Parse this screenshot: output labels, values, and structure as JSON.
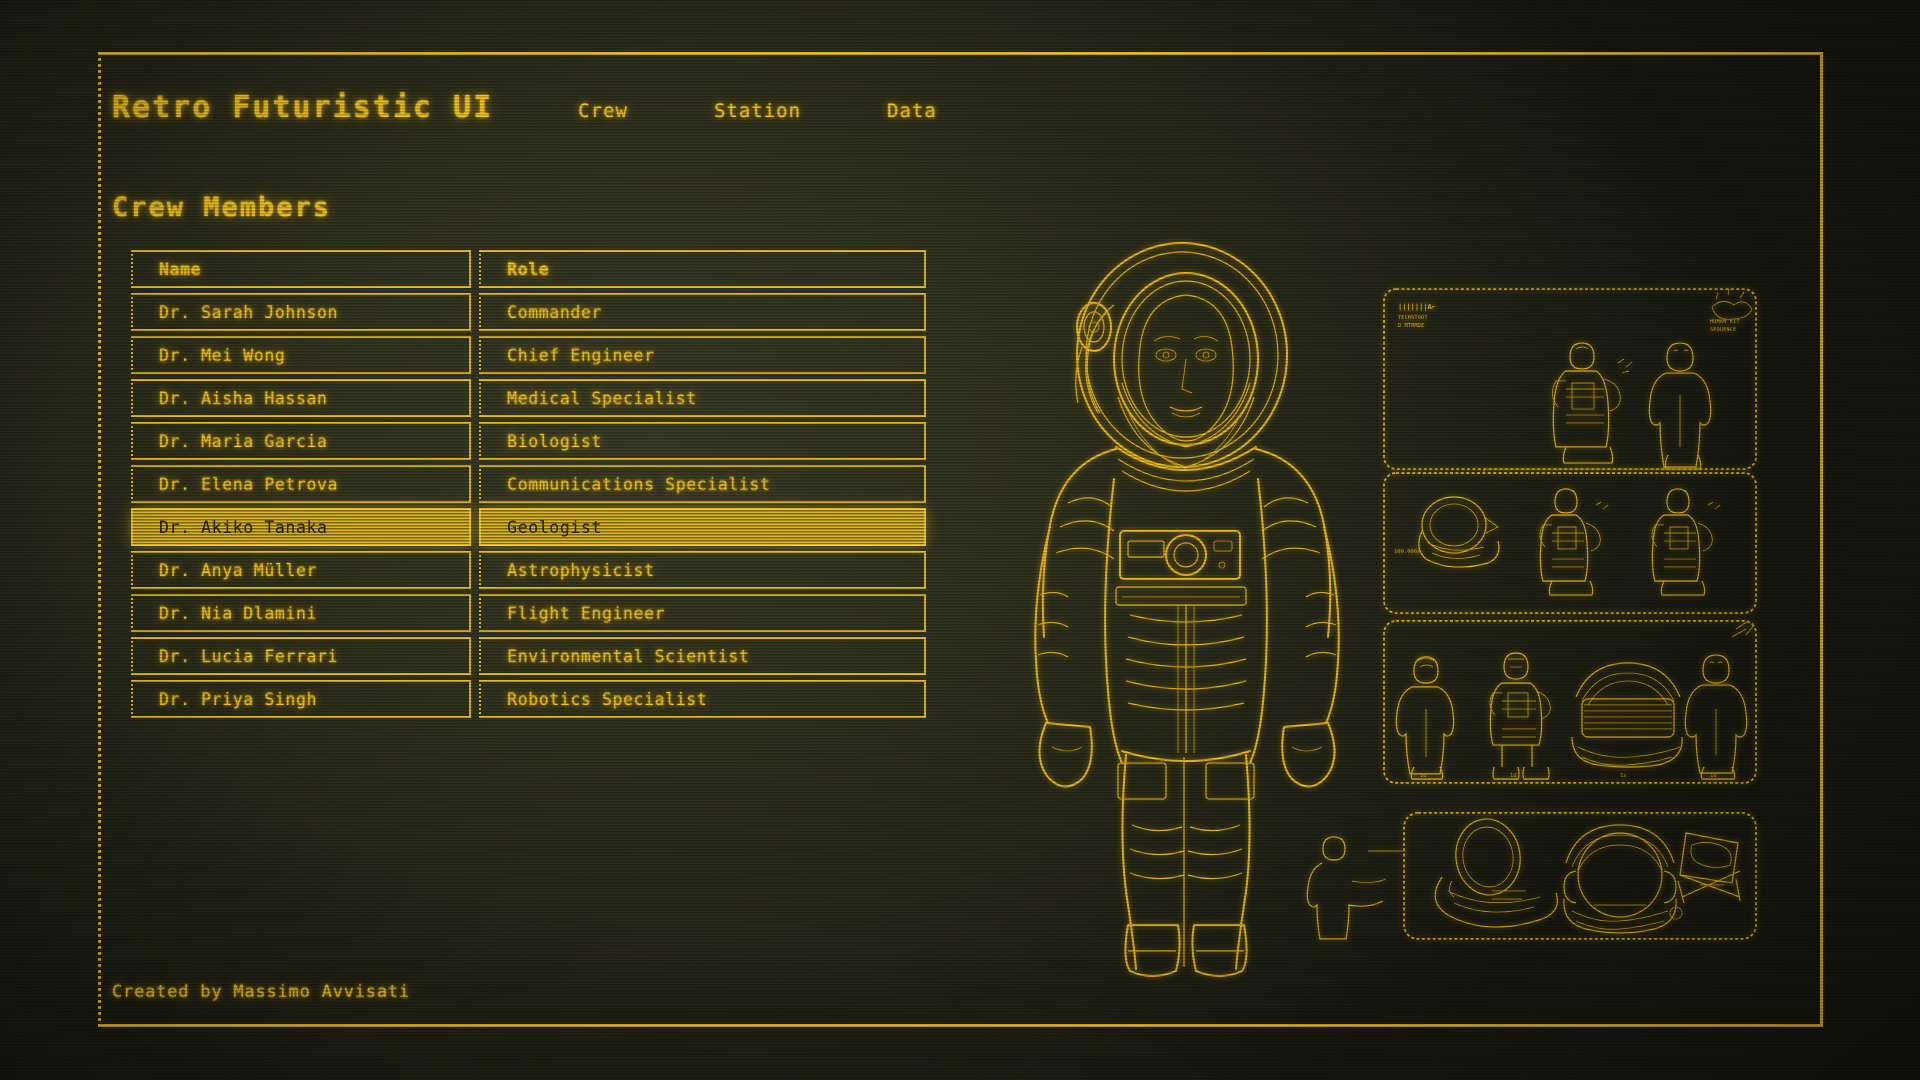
{
  "header": {
    "app_title": "Retro Futuristic UI",
    "nav": [
      {
        "label": "Crew"
      },
      {
        "label": "Station"
      },
      {
        "label": "Data"
      }
    ]
  },
  "section": {
    "title": "Crew Members"
  },
  "table": {
    "columns": [
      {
        "key": "name",
        "label": "Name"
      },
      {
        "key": "role",
        "label": "Role"
      }
    ],
    "rows": [
      {
        "name": "Dr. Sarah Johnson",
        "role": "Commander",
        "selected": false
      },
      {
        "name": "Dr. Mei Wong",
        "role": "Chief Engineer",
        "selected": false
      },
      {
        "name": "Dr. Aisha Hassan",
        "role": "Medical Specialist",
        "selected": false
      },
      {
        "name": "Dr. Maria Garcia",
        "role": "Biologist",
        "selected": false
      },
      {
        "name": "Dr. Elena Petrova",
        "role": "Communications Specialist",
        "selected": false
      },
      {
        "name": "Dr. Akiko Tanaka",
        "role": "Geologist",
        "selected": true
      },
      {
        "name": "Dr. Anya Müller",
        "role": "Astrophysicist",
        "selected": false
      },
      {
        "name": "Dr. Nia Dlamini",
        "role": "Flight Engineer",
        "selected": false
      },
      {
        "name": "Dr. Lucia Ferrari",
        "role": "Environmental Scientist",
        "selected": false
      },
      {
        "name": "Dr. Priya Singh",
        "role": "Robotics Specialist",
        "selected": false
      }
    ]
  },
  "footer": {
    "credit": "Created by Massimo Avvisati"
  },
  "artwork": {
    "astronaut": "astronaut-line-art-portrait",
    "blueprint_labels": {
      "top_left_code": "lllllllA",
      "top_left_sub": "TECHSTOOT  D MTMMDE",
      "top_right_sub": "HUMAN KIT  SEQUENCE",
      "scale_note": "100.000i",
      "figure_captions": [
        "1d",
        "1d",
        "1x",
        "1d"
      ]
    }
  },
  "colors": {
    "accent": "#f5c518",
    "accent_dim": "#e8b713",
    "background": "#32341f",
    "selected_bg": "#e0b81c",
    "selected_text": "#20220f"
  }
}
